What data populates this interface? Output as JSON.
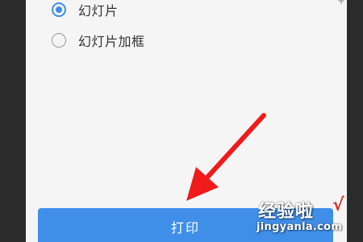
{
  "print_settings": {
    "options": [
      {
        "label": "幻灯片",
        "selected": true
      },
      {
        "label": "幻灯片加框",
        "selected": false
      }
    ],
    "print_button_label": "打印"
  },
  "corner_glyph": "+",
  "watermark": {
    "site_name": "经验啦",
    "checkmark": "√",
    "url": "jingyanla.com"
  },
  "colors": {
    "accent": "#3d8fe8",
    "button": "#3f8fe9",
    "sheet_background": "#f5f5f5",
    "outer_background": "#2b2b2b",
    "annotation_arrow": "#f01a1a"
  }
}
